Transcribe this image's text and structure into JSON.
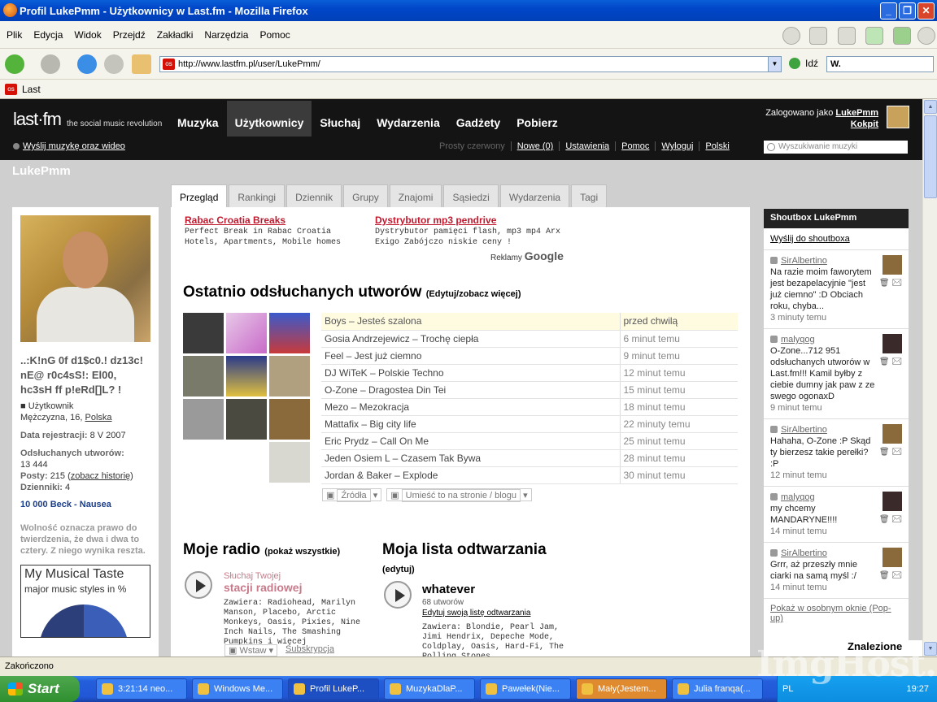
{
  "window": {
    "title": "Profil LukePmm - Użytkownicy w Last.fm - Mozilla Firefox"
  },
  "menu": [
    "Plik",
    "Edycja",
    "Widok",
    "Przejdź",
    "Zakładki",
    "Narzędzia",
    "Pomoc"
  ],
  "address": {
    "url": "http://www.lastfm.pl/user/LukePmm/",
    "go": "Idź",
    "search_engine_label": "W."
  },
  "bookmarks": {
    "item": "Last"
  },
  "lastfm": {
    "logo": "last·fm",
    "slogan": "the social music revolution",
    "nav": [
      "Muzyka",
      "Użytkownicy",
      "Słuchaj",
      "Wydarzenia",
      "Gadżety",
      "Pobierz"
    ],
    "logged_as": "Zalogowano jako",
    "logged_user": "LukePmm",
    "dashboard": "Kokpit",
    "upload_link": "Wyślij muzykę oraz wideo",
    "sub_links": [
      "Prosty czerwony",
      "Nowe (0)",
      "Ustawienia",
      "Pomoc",
      "Wyloguj",
      "Polski"
    ],
    "search_placeholder": "Wyszukiwanie muzyki"
  },
  "profile": {
    "username": "LukePmm",
    "tabs": [
      "Przegląd",
      "Rankingi",
      "Dziennik",
      "Grupy",
      "Znajomi",
      "Sąsiedzi",
      "Wydarzenia",
      "Tagi"
    ],
    "nickname": "..:K!nG 0f d1$c0.! dz13c! nE@ r0c4sS!: El00, hc3sH ff p!eRd[]L? !",
    "role": "Użytkownik",
    "info_prefix": "Mężczyzna, 16,",
    "country": "Polska",
    "reg_label": "Data rejestracji:",
    "reg_value": "8 V 2007",
    "plays_label": "Odsłuchanych utworów:",
    "plays_value": "13 444",
    "posts_label": "Posty:",
    "posts_value": "215",
    "posts_link": "zobacz historię",
    "journals_label": "Dzienniki:",
    "journals_value": "4",
    "now_track": "10 000 Beck - Nausea",
    "quote": "Wolność oznacza prawo do twierdzenia, że dwa i dwa to cztery. Z niego wynika reszta.",
    "taste_title": "My Musical Taste",
    "taste_sub": "major music styles in %"
  },
  "ads": [
    {
      "title": "Rabac Croatia Breaks",
      "text": "Perfect Break in Rabac Croatia Hotels, Apartments, Mobile homes"
    },
    {
      "title": "Dystrybutor mp3 pendrive",
      "text": "Dystrybutor pamięci flash, mp3 mp4 Arx Exigo Zabójczo niskie ceny !"
    }
  ],
  "ads_label": "Reklamy",
  "ads_brand": "Google",
  "recent": {
    "title": "Ostatnio odsłuchanych utworów",
    "edit": "(Edytuj/zobacz więcej)",
    "rows": [
      {
        "track": "Boys – Jesteś szalona",
        "time": "przed chwilą"
      },
      {
        "track": "Gosia Andrzejewicz – Trochę ciepła",
        "time": "6 minut temu"
      },
      {
        "track": "Feel – Jest już ciemno",
        "time": "9 minut temu"
      },
      {
        "track": "DJ WiTeK – Polskie Techno",
        "time": "12 minut temu"
      },
      {
        "track": "O-Zone – Dragostea Din Tei",
        "time": "15 minut temu"
      },
      {
        "track": "Mezo – Mezokracja",
        "time": "18 minut temu"
      },
      {
        "track": "Mattafix – Big city life",
        "time": "22 minuty temu"
      },
      {
        "track": "Eric Prydz – Call On Me",
        "time": "25 minut temu"
      },
      {
        "track": "Jeden Osiem L – Czasem Tak Bywa",
        "time": "28 minut temu"
      },
      {
        "track": "Jordan & Baker – Explode",
        "time": "30 minut temu"
      }
    ],
    "feed": "Źródła",
    "embed": "Umieść to na stronie / blogu"
  },
  "radio": {
    "title": "Moje radio",
    "show_all": "(pokaż wszystkie)",
    "listen": "Słuchaj Twojej",
    "station": "stacji radiowej",
    "contains": "Zawiera: Radiohead, Marilyn Manson, Placebo, Arctic Monkeys, Oasis, Pixies, Nine Inch Nails, The Smashing Pumpkins i więcej",
    "insert": "Wstaw",
    "subscribe": "Subskrypcja"
  },
  "playlist": {
    "title": "Moja lista odtwarzania",
    "edit": "(edytuj)",
    "name": "whatever",
    "count": "68 utworów",
    "edit_link": "Edytuj swoją listę odtwarzania",
    "contains": "Zawiera: Blondie, Pearl Jam, Jimi Hendrix, Depeche Mode, Coldplay, Oasis, Hard-Fi, The Rolling Stones,"
  },
  "shoutbox": {
    "title": "Shoutbox LukePmm",
    "send": "Wyślij do shoutboxa",
    "items": [
      {
        "who": "SirAlbertino",
        "text": "Na razie moim faworytem jest bezapelacyjnie \"jest już ciemno\" :D Obciach roku, chyba...",
        "when": "3 minuty temu",
        "color": "#8a6a3a"
      },
      {
        "who": "malyqog",
        "text": "O-Zone...712 951 odsłuchanych utworów w Last.fm!!! Kamil byłby z ciebie dumny jak paw z ze swego ogonaxD",
        "when": "9 minut temu",
        "color": "#3a2a2a"
      },
      {
        "who": "SirAlbertino",
        "text": "Hahaha, O-Zone :P Skąd ty bierzesz takie perełki? :P",
        "when": "12 minut temu",
        "color": "#8a6a3a"
      },
      {
        "who": "malyqog",
        "text": "my chcemy MANDARYNE!!!!",
        "when": "14 minut temu",
        "color": "#3a2a2a"
      },
      {
        "who": "SirAlbertino",
        "text": "Grrr, aż przeszły mnie ciarki na samą myśl :/",
        "when": "14 minut temu",
        "color": "#8a6a3a"
      }
    ],
    "popup": "Pokaż w osobnym oknie (Pop-up)"
  },
  "find": "Znalezione na:",
  "status": "Zakończono",
  "taskbar": {
    "start": "Start",
    "tasks": [
      "3:21:14 neo...",
      "Windows Me...",
      "Profil LukeP...",
      "MuzykaDlaP...",
      "Pawełek(Nie...",
      "Mały(Jestem...",
      "Julia franqa(..."
    ],
    "lang": "PL",
    "clock": "19:27"
  },
  "watermark": "ImgHost.pl",
  "colors": {
    "accent": "#d51007",
    "header": "#141414",
    "link_blue": "#1b3e8c"
  }
}
